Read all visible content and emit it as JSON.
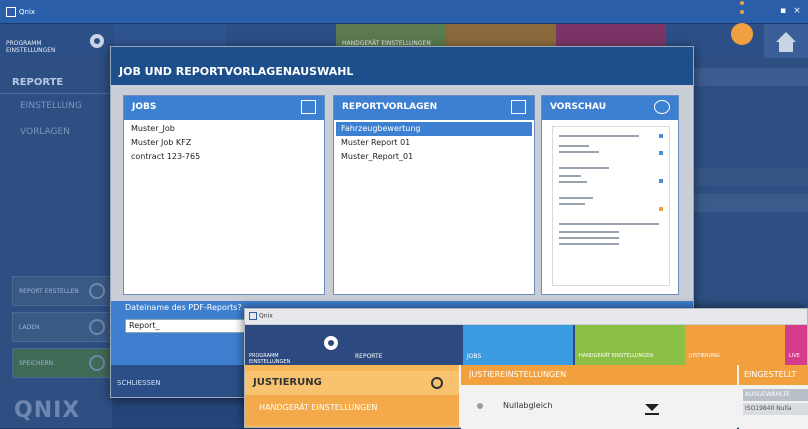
{
  "background_app": {
    "window_logo": "Qnix",
    "nav": {
      "programm_einstellungen": "PROGRAMM EINSTELLUNGEN",
      "tile_label": "HANDGERÄT EINSTELLUNGEN"
    },
    "sidebar": {
      "header": "REPORTE",
      "items": [
        {
          "label": "EINSTELLUNG"
        },
        {
          "label": "VORLAGEN"
        }
      ],
      "buttons": [
        {
          "label": "REPORT ERSTELLEN"
        },
        {
          "label": "LADEN"
        },
        {
          "label": "SPEICHERN"
        }
      ]
    },
    "brand": "QNIX"
  },
  "modal": {
    "title": "JOB UND REPORTVORLAGENAUSWAHL",
    "jobs": {
      "header": "JOBS",
      "items": [
        "Muster_Job",
        "Muster Job KFZ",
        "contract 123-765"
      ]
    },
    "reportvorlagen": {
      "header": "REPORTVORLAGEN",
      "items": [
        "Fahrzeugbewertung",
        "Muster Report 01",
        "Muster_Report_01"
      ],
      "selected_index": 0
    },
    "vorschau": {
      "header": "VORSCHAU"
    },
    "filename": {
      "label": "Dateiname des PDF-Reports?",
      "value": "Report_"
    },
    "close_label": "SCHLIESSEN"
  },
  "overlay_screenshot": {
    "window_logo": "Qnix",
    "nav": [
      {
        "label": "PROGRAMM EINSTELLUNGEN",
        "color": "#2c4a80"
      },
      {
        "label": "REPORTE",
        "color": "#2c4a80"
      },
      {
        "label": "JOBS",
        "color": "#3b9be0"
      },
      {
        "label": "HANDGERÄT EINSTELLUNGEN",
        "color": "#8bbf45"
      },
      {
        "label": "JUSTIERUNG",
        "color": "#f2a03e"
      },
      {
        "label": "LIVE",
        "color": "#d63c8c"
      }
    ],
    "left_header": "JUSTIERUNG",
    "left_item": "HANDGERÄT EINSTELLUNGEN",
    "mid_header": "JUSTIEREINSTELLUNGEN",
    "mid_row": "Nullabgleich",
    "right_header": "EINGESTELLT",
    "right_row1": "AUSGEWÄHLTE",
    "right_row2": "ISO19840 Nulla"
  },
  "colors": {
    "accent_blue": "#3d7fd1",
    "dark_blue": "#1d4f8d",
    "orange": "#f2a03e"
  }
}
